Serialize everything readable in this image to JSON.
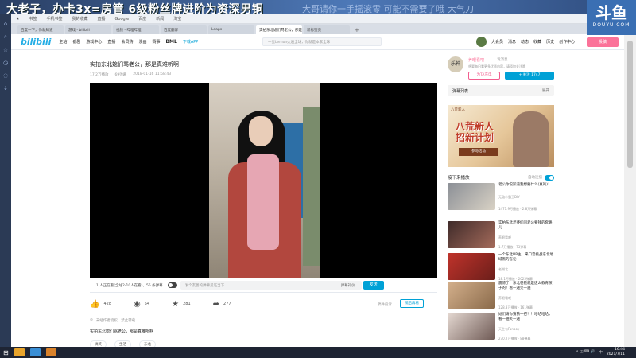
{
  "overlay": {
    "marquee": "大老子，办卡3x=房管 6级粉丝牌进阶为资深男铜",
    "marquee2": "大哥请你一手摇滚零   可能不需要了哦   大气刀",
    "douyu_big": "斗鱼",
    "douyu_small": "DOUYU.COM"
  },
  "bookmarks": [
    "书签",
    "手机书签",
    "我的收藏",
    "直播",
    "Google",
    "百度",
    "新闻",
    "淘宝"
  ],
  "tabs": [
    {
      "label": "百度一下，你就知道"
    },
    {
      "label": "游戏 - bilibili"
    },
    {
      "label": "视频 - 哔哩哔哩"
    },
    {
      "label": "百度翻译"
    },
    {
      "label": "Leaps"
    },
    {
      "label": "实拍东北媳们骂老公，那是..."
    },
    {
      "label": "新标签页"
    }
  ],
  "bili": {
    "logo": "bilibili",
    "nav": [
      "主站",
      "番剧",
      "游戏中心",
      "直播",
      "会员购",
      "漫画",
      "赛事"
    ],
    "bml": "BML",
    "download": "下载APP",
    "search_placeholder": "一觉Lemon火遍全球，你就是本家全球",
    "user_links": [
      "大会员",
      "消息",
      "动态",
      "收藏",
      "历史",
      "创作中心"
    ],
    "upload": "投稿"
  },
  "video": {
    "title": "实拍东北媳们骂老公，那是真难听啊",
    "views": "17.2万播放",
    "danmaku_count": "69弹幕",
    "date": "2018-01-16 11:58:43",
    "live_viewers": "1 人正在看(全站2-10人在看)，55 条弹幕",
    "danmaku_placeholder": "发个友善的弹幕见证当下",
    "etiquette": "弹幕礼仪",
    "send": "发送",
    "likes": "428",
    "coins": "54",
    "favs": "281",
    "shares": "277",
    "report": "稿件投诉",
    "add_list": "稍后再看",
    "notice_text": "未经作者授权，禁止转载",
    "description": "实拍东北媳们骂老公，那是真难听啊",
    "tags": [
      "搞笑",
      "生活",
      "东北"
    ]
  },
  "up": {
    "avatar_text": "乐神",
    "name": "养眼看吧",
    "msg": "发消息",
    "desc": "想要每日看更多优质内容，请添加关注哦",
    "charge": "为TA充电",
    "follow": "+ 关注 1747"
  },
  "sidebar": {
    "danmaku_list": "弹幕列表",
    "expand": "展开",
    "banner_small": "八荒新人",
    "banner_main_1": "八荒新人",
    "banner_main_2": "招新计划",
    "banner_btn": "参与活动",
    "next_label": "接下来播放",
    "autoplay": "自动连播"
  },
  "recs": [
    {
      "title": "老公你说知道我想要什么(真的)！",
      "up": "无敌小霸王DIY",
      "stats": "1471.9万播放 · 2.8万弹幕"
    },
    {
      "title": "实拍东北老婆们问老公要钱的套路儿",
      "up": "养眼看吧",
      "stats": "1.7万播放 · 73弹幕"
    },
    {
      "title": "一个东北UP主，来口音挑战东北地域黑的言论",
      "up": "老湖北",
      "stats": "18.1万播放 · 2025弹幕"
    },
    {
      "title": "震惊了！东北爸爸就是这么教育孩子的！看一遍笑一遍",
      "up": "养眼看吧",
      "stats": "128.3万播放 · 161弹幕"
    },
    {
      "title": "她们请你猜猜一把！！哈哈哈哈，看一遍笑一遍",
      "up": "天生有Fanboy",
      "stats": "270.2万播放 · 88弹幕"
    }
  ],
  "taskbar": {
    "time": "16:44",
    "date": "2021/7/11",
    "ime": "中",
    "tray": "∧ ◫ ⌨ 🔊"
  },
  "colors": {
    "accent": "#00a1d6",
    "pink": "#fb7299"
  }
}
